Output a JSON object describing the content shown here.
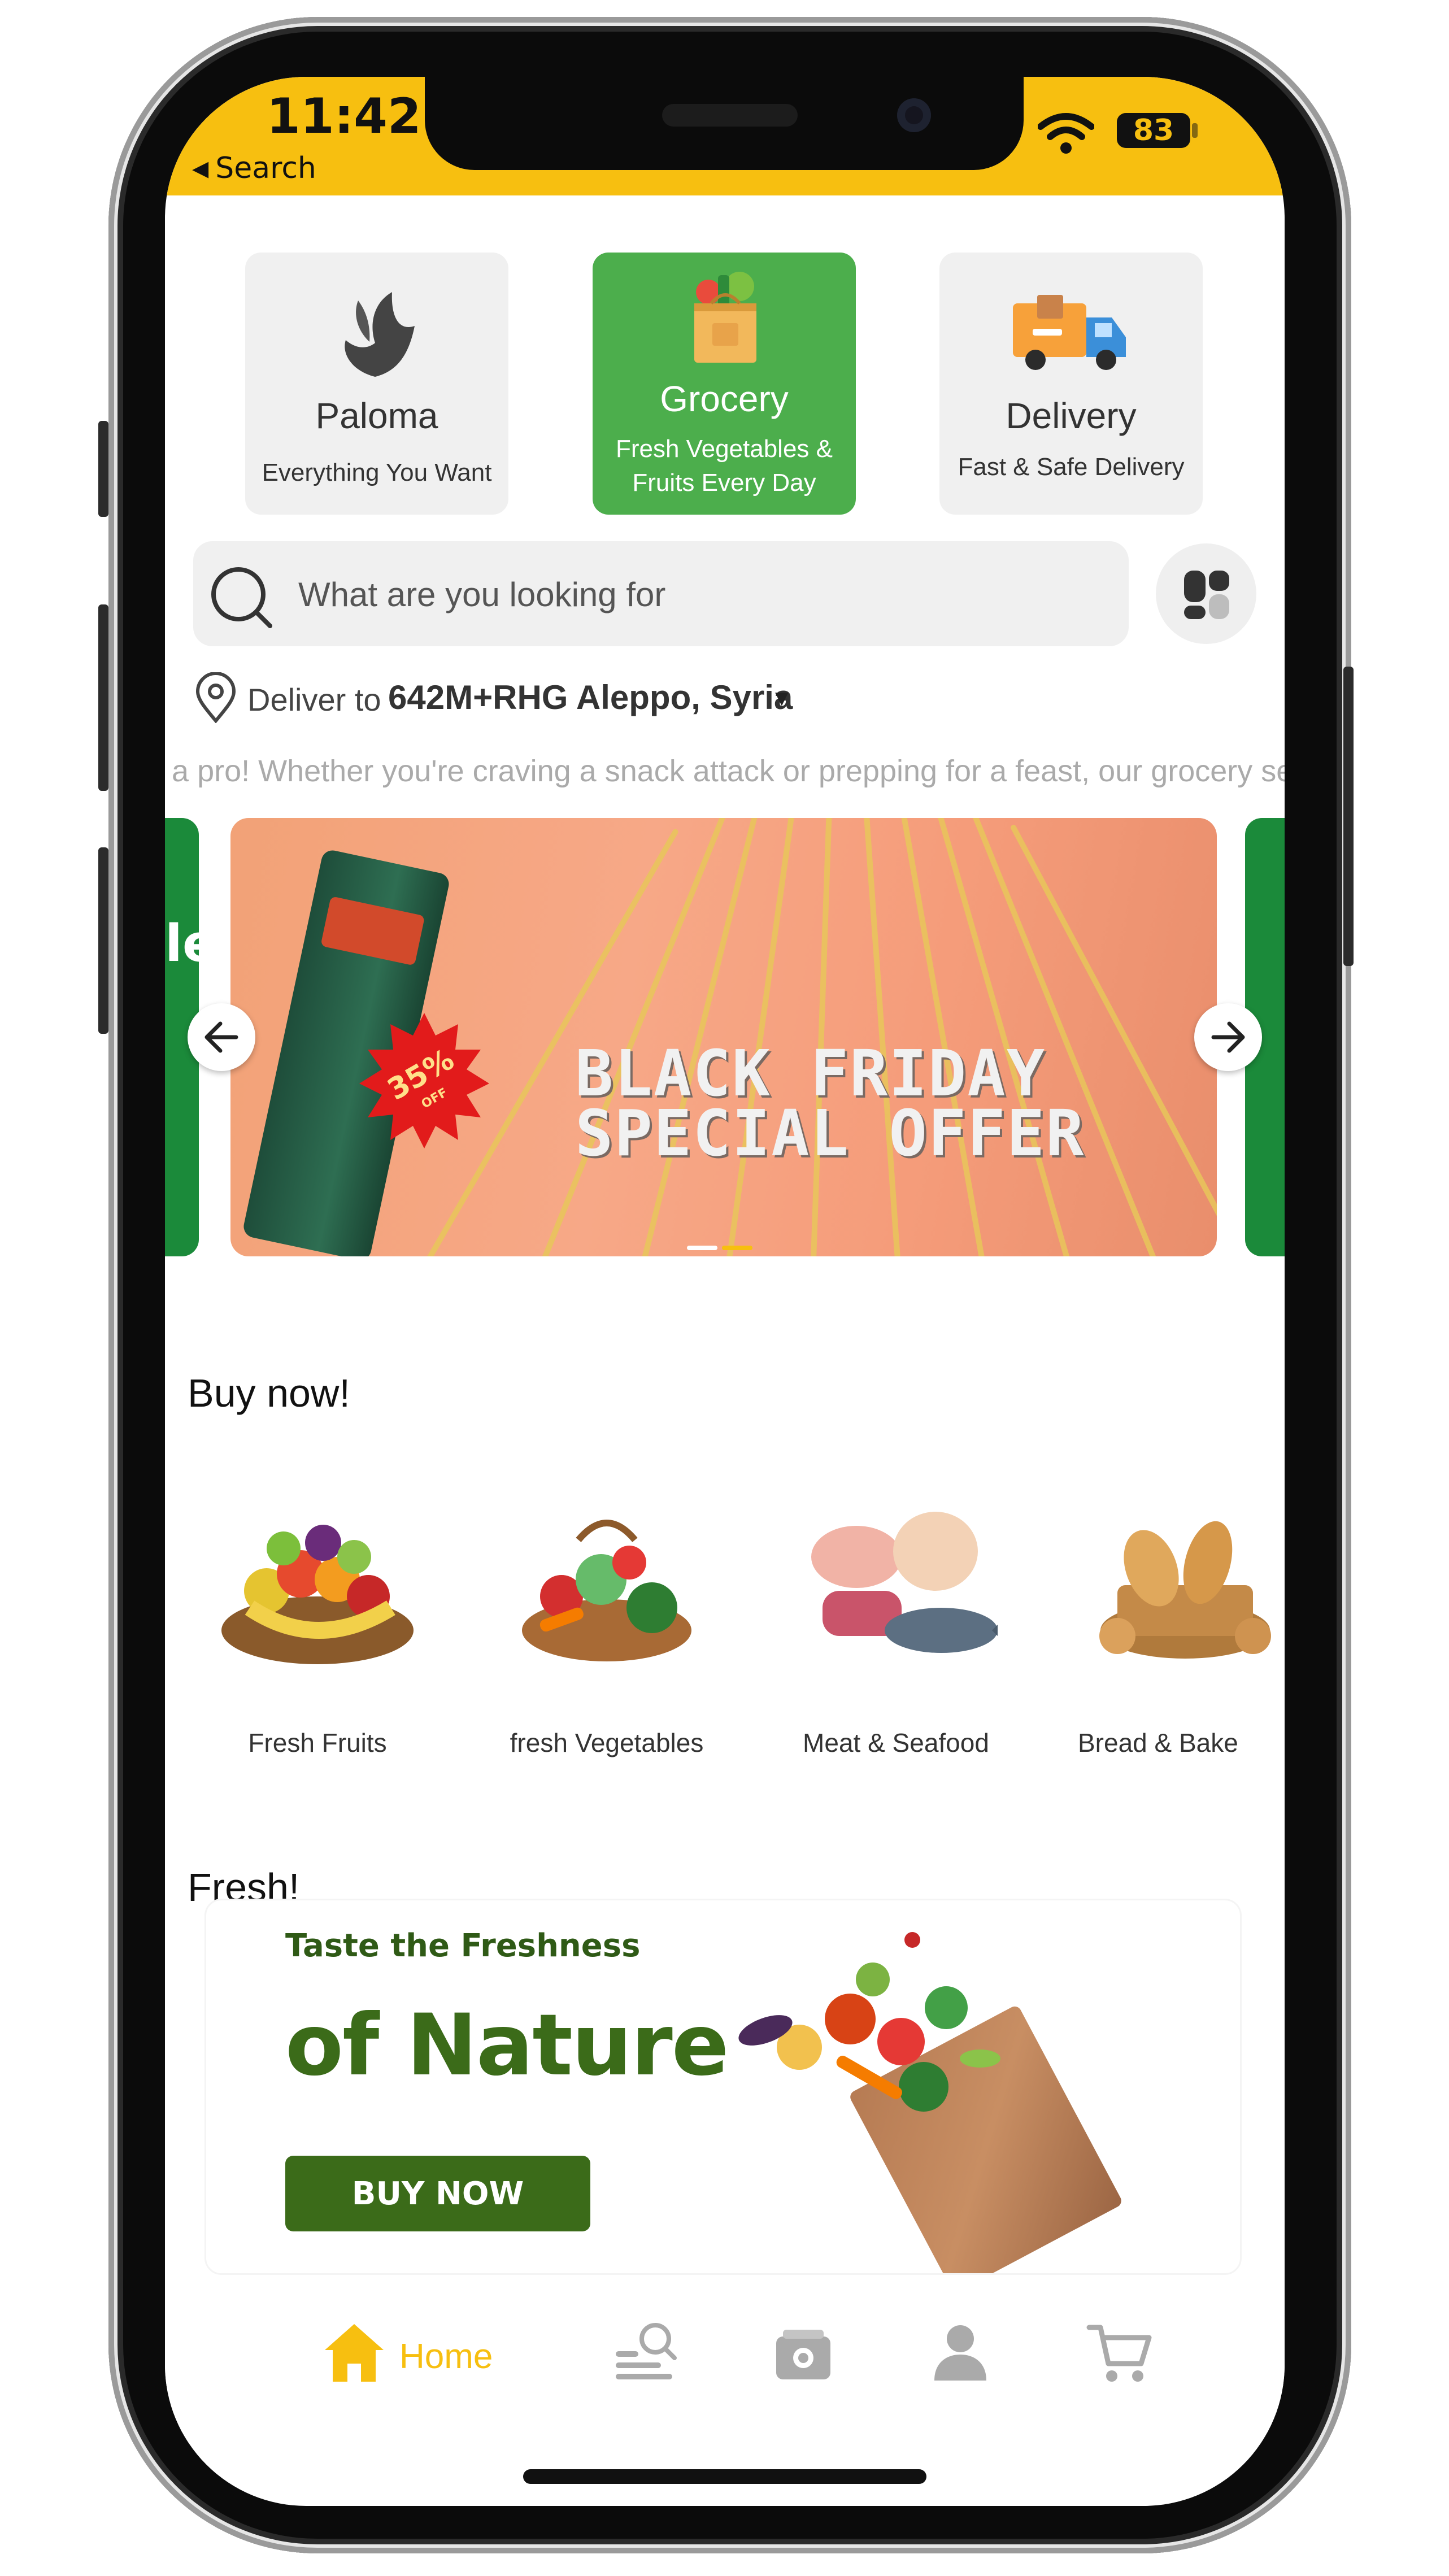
{
  "status_bar": {
    "time": "11:42",
    "back_label": "Search",
    "battery": "83",
    "accent_color": "#f7bf10"
  },
  "categories_top": [
    {
      "title": "Paloma",
      "subtitle": "Everything You Want",
      "icon": "dove-icon"
    },
    {
      "title": "Grocery",
      "subtitle": "Fresh Vegetables & Fruits Every Day",
      "icon": "grocery-bag-icon",
      "active_color": "#4cae4c"
    },
    {
      "title": "Delivery",
      "subtitle": "Fast & Safe Delivery",
      "icon": "delivery-truck-icon"
    }
  ],
  "search": {
    "placeholder": "What are you looking for"
  },
  "deliver": {
    "label": "Deliver to",
    "address": "642M+RHG Aleppo, Syria"
  },
  "marquee_text": "ke a pro! Whether you're craving a snack attack or prepping for a feast, our grocery sec",
  "banner": {
    "badge_percent": "35%",
    "badge_off": "OFF",
    "headline_line1": "BLACK FRIDAY",
    "headline_line2": "SPECIAL OFFER",
    "prev_peek_text": "le"
  },
  "buy_now": {
    "title": "Buy now!",
    "items": [
      {
        "label": "Fresh Fruits"
      },
      {
        "label": "fresh Vegetables"
      },
      {
        "label": "Meat & Seafood"
      },
      {
        "label": "Bread & Bake"
      }
    ]
  },
  "fresh": {
    "title": "Fresh!",
    "banner_line1": "Taste the Freshness",
    "banner_line2": "of Nature",
    "banner_button": "BUY NOW"
  },
  "bottom_nav": {
    "home_label": "Home",
    "items": [
      "home-icon",
      "search-list-icon",
      "wallet-icon",
      "profile-icon",
      "cart-icon"
    ]
  }
}
